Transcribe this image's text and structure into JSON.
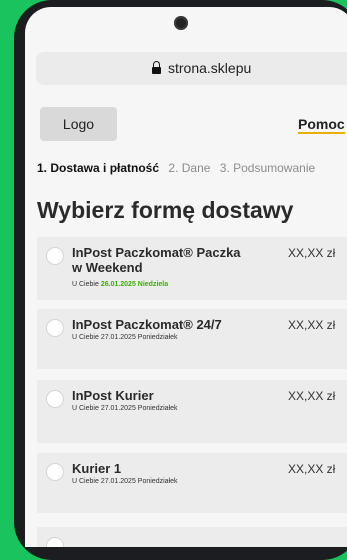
{
  "browser": {
    "url": "strona.sklepu"
  },
  "header": {
    "logo_label": "Logo",
    "help_label": "Pomoc"
  },
  "steps": [
    {
      "label": "1. Dostawa i płatność",
      "active": true
    },
    {
      "label": "2. Dane",
      "active": false
    },
    {
      "label": "3. Podsumowanie",
      "active": false
    }
  ],
  "title": "Wybierz formę dostawy",
  "options": [
    {
      "name": "InPost Paczkomat® Paczka w Weekend",
      "date_prefix": "U Ciebie",
      "date_highlight": "26.01.2025 Niedziela",
      "date": "",
      "price": "XX,XX zł"
    },
    {
      "name": "InPost Paczkomat® 24/7",
      "date_prefix": "U Ciebie",
      "date_highlight": "",
      "date": "27.01.2025 Poniedziałek",
      "price": "XX,XX zł"
    },
    {
      "name": "InPost Kurier",
      "date_prefix": "U Ciebie",
      "date_highlight": "",
      "date": "27.01.2025 Poniedziałek",
      "price": "XX,XX zł"
    },
    {
      "name": "Kurier 1",
      "date_prefix": "U Ciebie",
      "date_highlight": "",
      "date": "27.01.2025 Poniedziałek",
      "price": "XX,XX zł"
    }
  ],
  "colors": {
    "background": "#19c45c",
    "accent_underline": "#e8b000",
    "highlight_date": "#38b000"
  }
}
